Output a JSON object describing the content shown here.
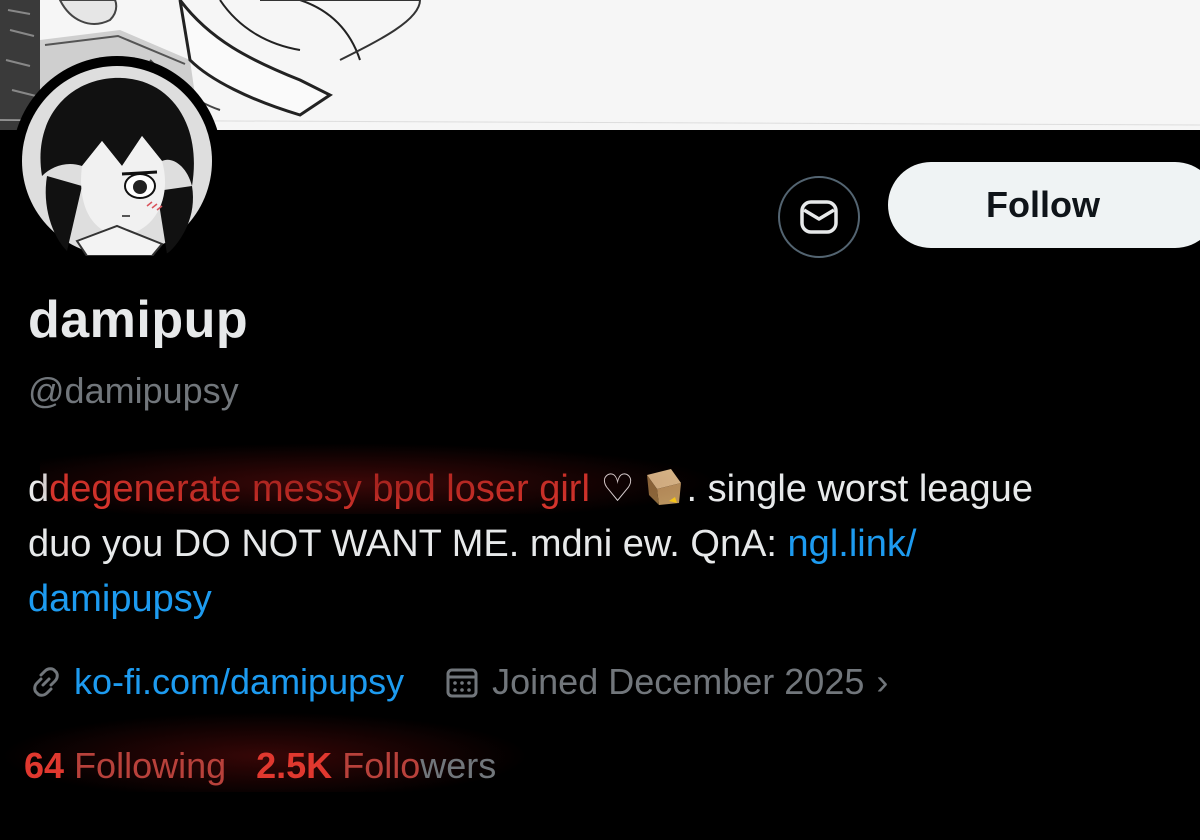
{
  "profile": {
    "display_name": "damipup",
    "handle": "@damipupsy",
    "follow_label": "Follow",
    "message_icon": "envelope-icon"
  },
  "bio": {
    "highlight": "degenerate messy bpd loser girl",
    "first_letter": "d",
    "heart": "♡",
    "rest_line1": ". single worst league",
    "line2_text": "duo you DO NOT WANT ME. mdni ew. QnA: ",
    "link_part1": "ngl.link/",
    "link_part2": "damipupsy",
    "emoji": "box-emoji"
  },
  "meta": {
    "link_icon": "link-icon",
    "website": "ko-fi.com/damipupsy",
    "calendar_icon": "calendar-icon",
    "joined": "Joined December 2025",
    "chevron": "›"
  },
  "stats": {
    "following_count": "64",
    "following_label": "Following",
    "followers_count": "2.5K",
    "followers_label_red": "Follo",
    "followers_label_grey": "wers"
  },
  "colors": {
    "background": "#000000",
    "text": "#e7e9ea",
    "muted": "#71767b",
    "link": "#1d9bf0",
    "highlight_red": "#e0382f",
    "follow_button_bg": "#eff3f4"
  }
}
